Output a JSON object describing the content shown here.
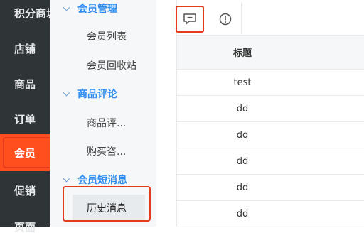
{
  "rail": {
    "items": [
      {
        "label": "积分商城"
      },
      {
        "label": "店铺"
      },
      {
        "label": "商品"
      },
      {
        "label": "订单"
      },
      {
        "label": "会员"
      },
      {
        "label": "促销"
      },
      {
        "label": "页面"
      }
    ],
    "active_index": 4
  },
  "submenu": {
    "groups": [
      {
        "title": "会员管理",
        "items": [
          "会员列表",
          "会员回收站"
        ]
      },
      {
        "title": "商品评论",
        "items": [
          "商品评...",
          "购买咨..."
        ]
      },
      {
        "title": "会员短消息",
        "items": [
          "历史消息"
        ]
      }
    ]
  },
  "toolbar": {
    "buttons": [
      {
        "icon": "message-icon",
        "selected": true
      },
      {
        "icon": "info-circle-icon",
        "selected": false
      }
    ]
  },
  "table": {
    "header": "标题",
    "rows": [
      "test",
      "dd",
      "dd",
      "dd",
      "dd",
      "dd"
    ]
  },
  "colors": {
    "rail_bg": "#2f3437",
    "accent": "#ff4f1f",
    "link_blue": "#2d8cf0",
    "highlight": "#e53a1c"
  }
}
